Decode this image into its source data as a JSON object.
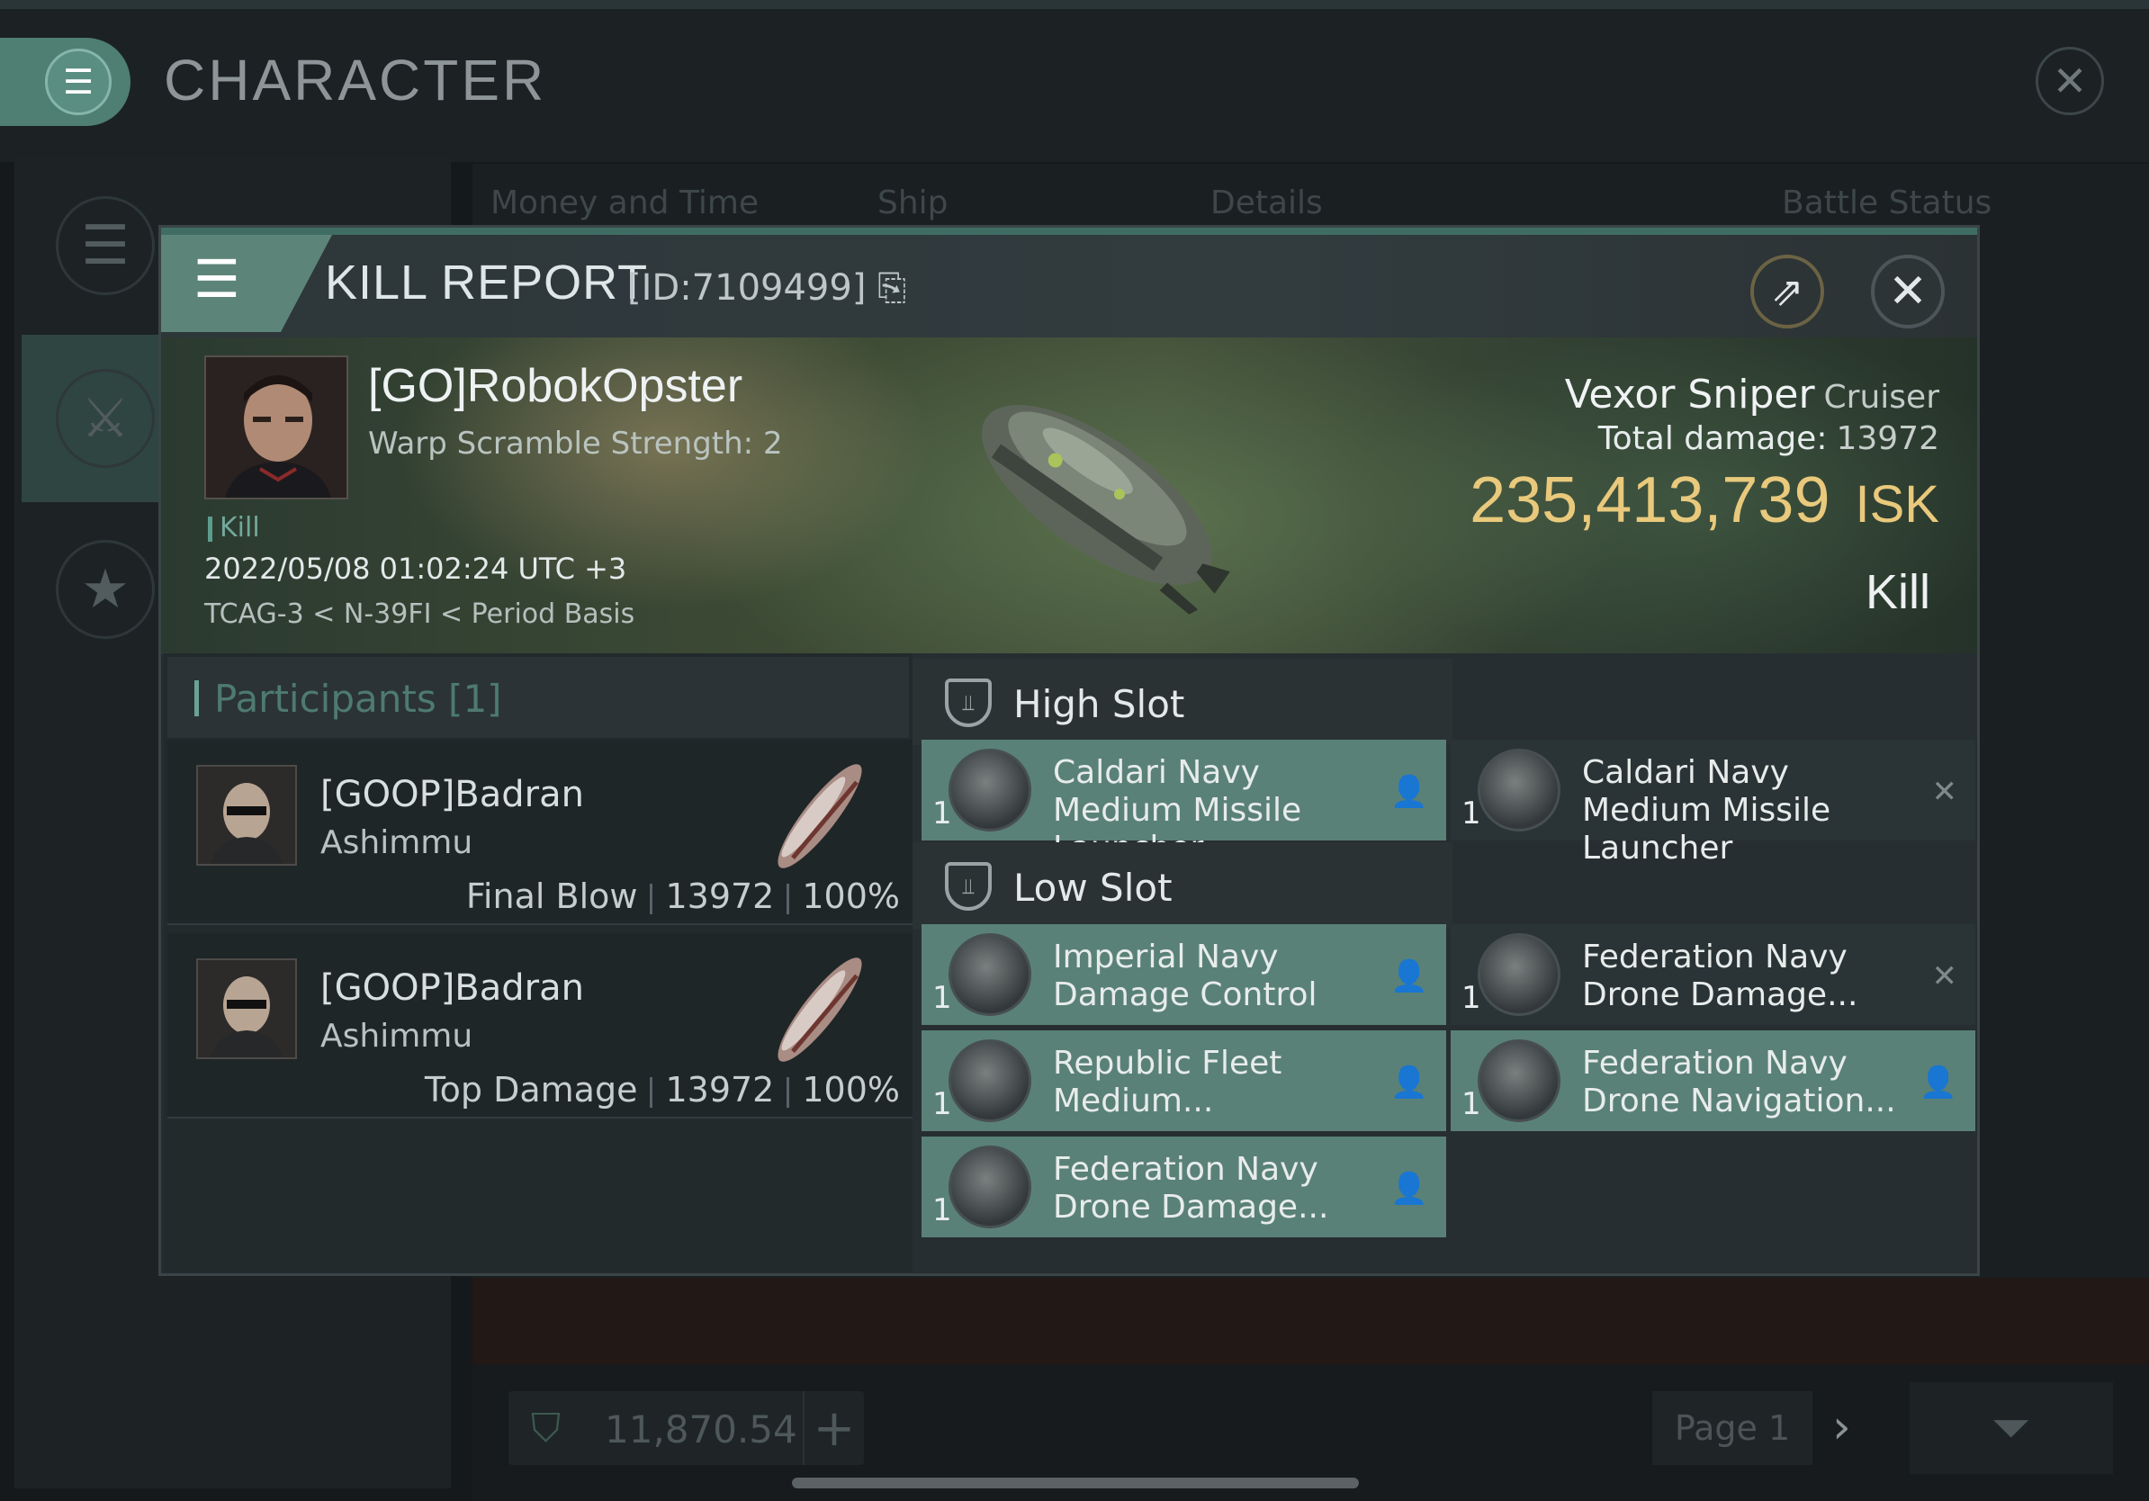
{
  "background": {
    "title": "CHARACTER",
    "columns": [
      "Money and Time",
      "Ship",
      "Details",
      "Battle Status"
    ],
    "wallet_value": "11,870.54",
    "page_label": "Page 1"
  },
  "modal": {
    "title": "KILL REPORT",
    "id_label": "[ID:7109499]",
    "victim": {
      "name": "[GO]RobokOpster",
      "warp_scramble": "Warp Scramble Strength: 2",
      "tag": "Kill",
      "datetime": "2022/05/08 01:02:24 UTC +3",
      "location": "TCAG-3 < N-39FI < Period Basis"
    },
    "ship": {
      "name": "Vexor Sniper",
      "class": "Cruiser",
      "total_damage_label": "Total damage:",
      "total_damage_value": "13972",
      "isk_value": "235,413,739",
      "isk_unit": "ISK",
      "result": "Kill"
    },
    "participants": {
      "title": "Participants [1]",
      "rows": [
        {
          "name": "[GOOP]Badran",
          "ship": "Ashimmu",
          "role": "Final Blow",
          "damage": "13972",
          "percent": "100%"
        },
        {
          "name": "[GOOP]Badran",
          "ship": "Ashimmu",
          "role": "Top Damage",
          "damage": "13972",
          "percent": "100%"
        }
      ]
    },
    "slots": {
      "high": {
        "title": "High Slot",
        "fitted": [
          {
            "qty": "1",
            "name": "Caldari Navy Medium Missile Launcher",
            "icon": "missile-launcher-icon"
          }
        ],
        "dropped": [
          {
            "qty": "1",
            "name": "Caldari Navy Medium Missile Launcher",
            "icon": "missile-launcher-icon"
          }
        ]
      },
      "low": {
        "title": "Low Slot",
        "fitted": [
          {
            "qty": "1",
            "name": "Imperial Navy Damage Control",
            "icon": "damage-control-icon"
          },
          {
            "qty": "1",
            "name": "Republic Fleet Medium...",
            "icon": "armor-repairer-icon"
          },
          {
            "qty": "1",
            "name": "Federation Navy Drone Damage...",
            "icon": "drone-upgrade-icon"
          }
        ],
        "dropped": [
          {
            "qty": "1",
            "name": "Federation Navy Drone Damage...",
            "icon": "drone-upgrade-icon",
            "status": "destroyed"
          },
          {
            "qty": "1",
            "name": "Federation Navy Drone Navigation...",
            "icon": "drone-upgrade-icon",
            "status": "fitted"
          }
        ]
      }
    }
  },
  "colors": {
    "accent": "#5a8177",
    "isk": "#e9c97c",
    "background": "#15191b"
  }
}
